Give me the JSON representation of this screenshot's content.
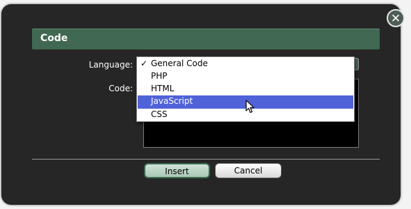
{
  "dialog": {
    "title": "Code",
    "close_glyph": "✕",
    "language_label": "Language:",
    "code_label": "Code:",
    "code_value": "",
    "selected_language": "General Code"
  },
  "dropdown": {
    "options": [
      {
        "label": "General Code",
        "check": "✓"
      },
      {
        "label": "PHP",
        "check": ""
      },
      {
        "label": "HTML",
        "check": ""
      },
      {
        "label": "JavaScript",
        "check": ""
      },
      {
        "label": "CSS",
        "check": ""
      }
    ],
    "highlighted": "JavaScript"
  },
  "buttons": {
    "insert": "Insert",
    "cancel": "Cancel"
  },
  "colors": {
    "title_bar": "#416852",
    "dialog_bg": "#262626",
    "highlight": "#4f62d8"
  }
}
